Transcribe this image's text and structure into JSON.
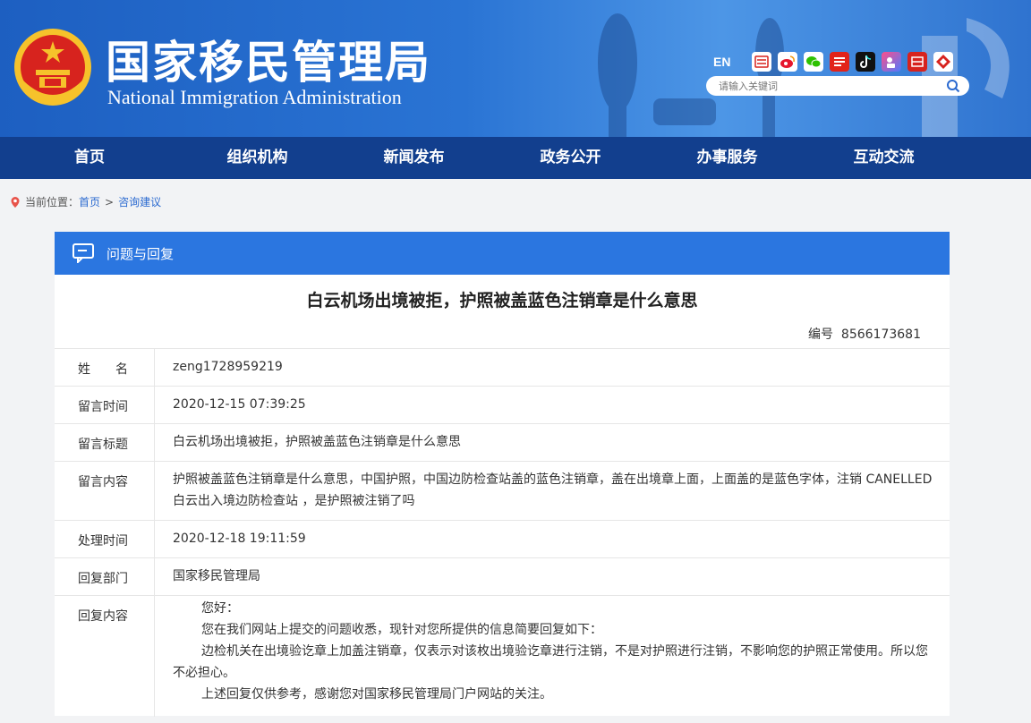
{
  "header": {
    "title_cn": "国家移民管理局",
    "title_en": "National Immigration Administration",
    "lang_switch": "EN",
    "search_placeholder": "请输入关键词",
    "social_icons": [
      "mail-icon",
      "weibo-icon",
      "wechat-icon",
      "toutiao-icon",
      "douyin-icon",
      "kuaishou-icon",
      "people-app-icon",
      "app-icon"
    ],
    "colors": {
      "header_blue": "#2a74d4",
      "nav_blue": "#123f8e",
      "panel_blue": "#2b76e0",
      "emblem_red": "#d7231e",
      "emblem_gold": "#f6c22b"
    }
  },
  "nav": {
    "items": [
      "首页",
      "组织机构",
      "新闻发布",
      "政务公开",
      "办事服务",
      "互动交流"
    ]
  },
  "breadcrumb": {
    "label": "当前位置：",
    "home": "首页",
    "separator": ">",
    "current": "咨询建议"
  },
  "panel": {
    "heading": "问题与回复",
    "question_title": "白云机场出境被拒，护照被盖蓝色注销章是什么意思",
    "serial_label": "编号",
    "serial_value": "8566173681",
    "rows": [
      {
        "label": "姓　　名",
        "value": "zeng1728959219"
      },
      {
        "label": "留言时间",
        "value": "2020-12-15 07:39:25"
      },
      {
        "label": "留言标题",
        "value": "白云机场出境被拒，护照被盖蓝色注销章是什么意思"
      },
      {
        "label": "留言内容",
        "value": "护照被盖蓝色注销章是什么意思，中国护照，中国边防检查站盖的蓝色注销章，盖在出境章上面，上面盖的是蓝色字体，注销 CANELLED 白云出入境边防检查站 ，是护照被注销了吗"
      },
      {
        "label": "处理时间",
        "value": "2020-12-18 19:11:59"
      },
      {
        "label": "回复部门",
        "value": "国家移民管理局"
      },
      {
        "label": "回复内容",
        "lines": [
          "您好：",
          "您在我们网站上提交的问题收悉，现针对您所提供的信息简要回复如下：",
          "边检机关在出境验讫章上加盖注销章，仅表示对该枚出境验讫章进行注销，不是对护照进行注销，不影响您的护照正常使用。所以您不必担心。",
          "上述回复仅供参考，感谢您对国家移民管理局门户网站的关注。"
        ]
      }
    ]
  }
}
